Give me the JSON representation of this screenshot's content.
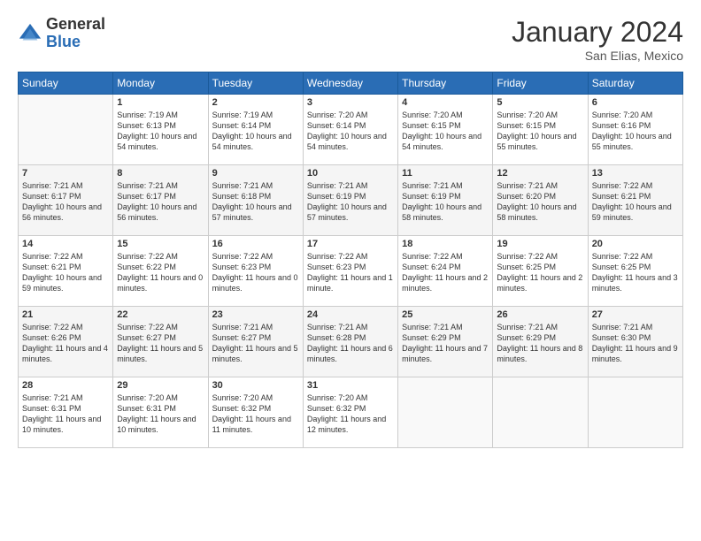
{
  "logo": {
    "general": "General",
    "blue": "Blue"
  },
  "header": {
    "month": "January 2024",
    "location": "San Elias, Mexico"
  },
  "weekdays": [
    "Sunday",
    "Monday",
    "Tuesday",
    "Wednesday",
    "Thursday",
    "Friday",
    "Saturday"
  ],
  "weeks": [
    [
      {
        "day": "",
        "sunrise": "",
        "sunset": "",
        "daylight": ""
      },
      {
        "day": "1",
        "sunrise": "Sunrise: 7:19 AM",
        "sunset": "Sunset: 6:13 PM",
        "daylight": "Daylight: 10 hours and 54 minutes."
      },
      {
        "day": "2",
        "sunrise": "Sunrise: 7:19 AM",
        "sunset": "Sunset: 6:14 PM",
        "daylight": "Daylight: 10 hours and 54 minutes."
      },
      {
        "day": "3",
        "sunrise": "Sunrise: 7:20 AM",
        "sunset": "Sunset: 6:14 PM",
        "daylight": "Daylight: 10 hours and 54 minutes."
      },
      {
        "day": "4",
        "sunrise": "Sunrise: 7:20 AM",
        "sunset": "Sunset: 6:15 PM",
        "daylight": "Daylight: 10 hours and 54 minutes."
      },
      {
        "day": "5",
        "sunrise": "Sunrise: 7:20 AM",
        "sunset": "Sunset: 6:15 PM",
        "daylight": "Daylight: 10 hours and 55 minutes."
      },
      {
        "day": "6",
        "sunrise": "Sunrise: 7:20 AM",
        "sunset": "Sunset: 6:16 PM",
        "daylight": "Daylight: 10 hours and 55 minutes."
      }
    ],
    [
      {
        "day": "7",
        "sunrise": "Sunrise: 7:21 AM",
        "sunset": "Sunset: 6:17 PM",
        "daylight": "Daylight: 10 hours and 56 minutes."
      },
      {
        "day": "8",
        "sunrise": "Sunrise: 7:21 AM",
        "sunset": "Sunset: 6:17 PM",
        "daylight": "Daylight: 10 hours and 56 minutes."
      },
      {
        "day": "9",
        "sunrise": "Sunrise: 7:21 AM",
        "sunset": "Sunset: 6:18 PM",
        "daylight": "Daylight: 10 hours and 57 minutes."
      },
      {
        "day": "10",
        "sunrise": "Sunrise: 7:21 AM",
        "sunset": "Sunset: 6:19 PM",
        "daylight": "Daylight: 10 hours and 57 minutes."
      },
      {
        "day": "11",
        "sunrise": "Sunrise: 7:21 AM",
        "sunset": "Sunset: 6:19 PM",
        "daylight": "Daylight: 10 hours and 58 minutes."
      },
      {
        "day": "12",
        "sunrise": "Sunrise: 7:21 AM",
        "sunset": "Sunset: 6:20 PM",
        "daylight": "Daylight: 10 hours and 58 minutes."
      },
      {
        "day": "13",
        "sunrise": "Sunrise: 7:22 AM",
        "sunset": "Sunset: 6:21 PM",
        "daylight": "Daylight: 10 hours and 59 minutes."
      }
    ],
    [
      {
        "day": "14",
        "sunrise": "Sunrise: 7:22 AM",
        "sunset": "Sunset: 6:21 PM",
        "daylight": "Daylight: 10 hours and 59 minutes."
      },
      {
        "day": "15",
        "sunrise": "Sunrise: 7:22 AM",
        "sunset": "Sunset: 6:22 PM",
        "daylight": "Daylight: 11 hours and 0 minutes."
      },
      {
        "day": "16",
        "sunrise": "Sunrise: 7:22 AM",
        "sunset": "Sunset: 6:23 PM",
        "daylight": "Daylight: 11 hours and 0 minutes."
      },
      {
        "day": "17",
        "sunrise": "Sunrise: 7:22 AM",
        "sunset": "Sunset: 6:23 PM",
        "daylight": "Daylight: 11 hours and 1 minute."
      },
      {
        "day": "18",
        "sunrise": "Sunrise: 7:22 AM",
        "sunset": "Sunset: 6:24 PM",
        "daylight": "Daylight: 11 hours and 2 minutes."
      },
      {
        "day": "19",
        "sunrise": "Sunrise: 7:22 AM",
        "sunset": "Sunset: 6:25 PM",
        "daylight": "Daylight: 11 hours and 2 minutes."
      },
      {
        "day": "20",
        "sunrise": "Sunrise: 7:22 AM",
        "sunset": "Sunset: 6:25 PM",
        "daylight": "Daylight: 11 hours and 3 minutes."
      }
    ],
    [
      {
        "day": "21",
        "sunrise": "Sunrise: 7:22 AM",
        "sunset": "Sunset: 6:26 PM",
        "daylight": "Daylight: 11 hours and 4 minutes."
      },
      {
        "day": "22",
        "sunrise": "Sunrise: 7:22 AM",
        "sunset": "Sunset: 6:27 PM",
        "daylight": "Daylight: 11 hours and 5 minutes."
      },
      {
        "day": "23",
        "sunrise": "Sunrise: 7:21 AM",
        "sunset": "Sunset: 6:27 PM",
        "daylight": "Daylight: 11 hours and 5 minutes."
      },
      {
        "day": "24",
        "sunrise": "Sunrise: 7:21 AM",
        "sunset": "Sunset: 6:28 PM",
        "daylight": "Daylight: 11 hours and 6 minutes."
      },
      {
        "day": "25",
        "sunrise": "Sunrise: 7:21 AM",
        "sunset": "Sunset: 6:29 PM",
        "daylight": "Daylight: 11 hours and 7 minutes."
      },
      {
        "day": "26",
        "sunrise": "Sunrise: 7:21 AM",
        "sunset": "Sunset: 6:29 PM",
        "daylight": "Daylight: 11 hours and 8 minutes."
      },
      {
        "day": "27",
        "sunrise": "Sunrise: 7:21 AM",
        "sunset": "Sunset: 6:30 PM",
        "daylight": "Daylight: 11 hours and 9 minutes."
      }
    ],
    [
      {
        "day": "28",
        "sunrise": "Sunrise: 7:21 AM",
        "sunset": "Sunset: 6:31 PM",
        "daylight": "Daylight: 11 hours and 10 minutes."
      },
      {
        "day": "29",
        "sunrise": "Sunrise: 7:20 AM",
        "sunset": "Sunset: 6:31 PM",
        "daylight": "Daylight: 11 hours and 10 minutes."
      },
      {
        "day": "30",
        "sunrise": "Sunrise: 7:20 AM",
        "sunset": "Sunset: 6:32 PM",
        "daylight": "Daylight: 11 hours and 11 minutes."
      },
      {
        "day": "31",
        "sunrise": "Sunrise: 7:20 AM",
        "sunset": "Sunset: 6:32 PM",
        "daylight": "Daylight: 11 hours and 12 minutes."
      },
      {
        "day": "",
        "sunrise": "",
        "sunset": "",
        "daylight": ""
      },
      {
        "day": "",
        "sunrise": "",
        "sunset": "",
        "daylight": ""
      },
      {
        "day": "",
        "sunrise": "",
        "sunset": "",
        "daylight": ""
      }
    ]
  ]
}
